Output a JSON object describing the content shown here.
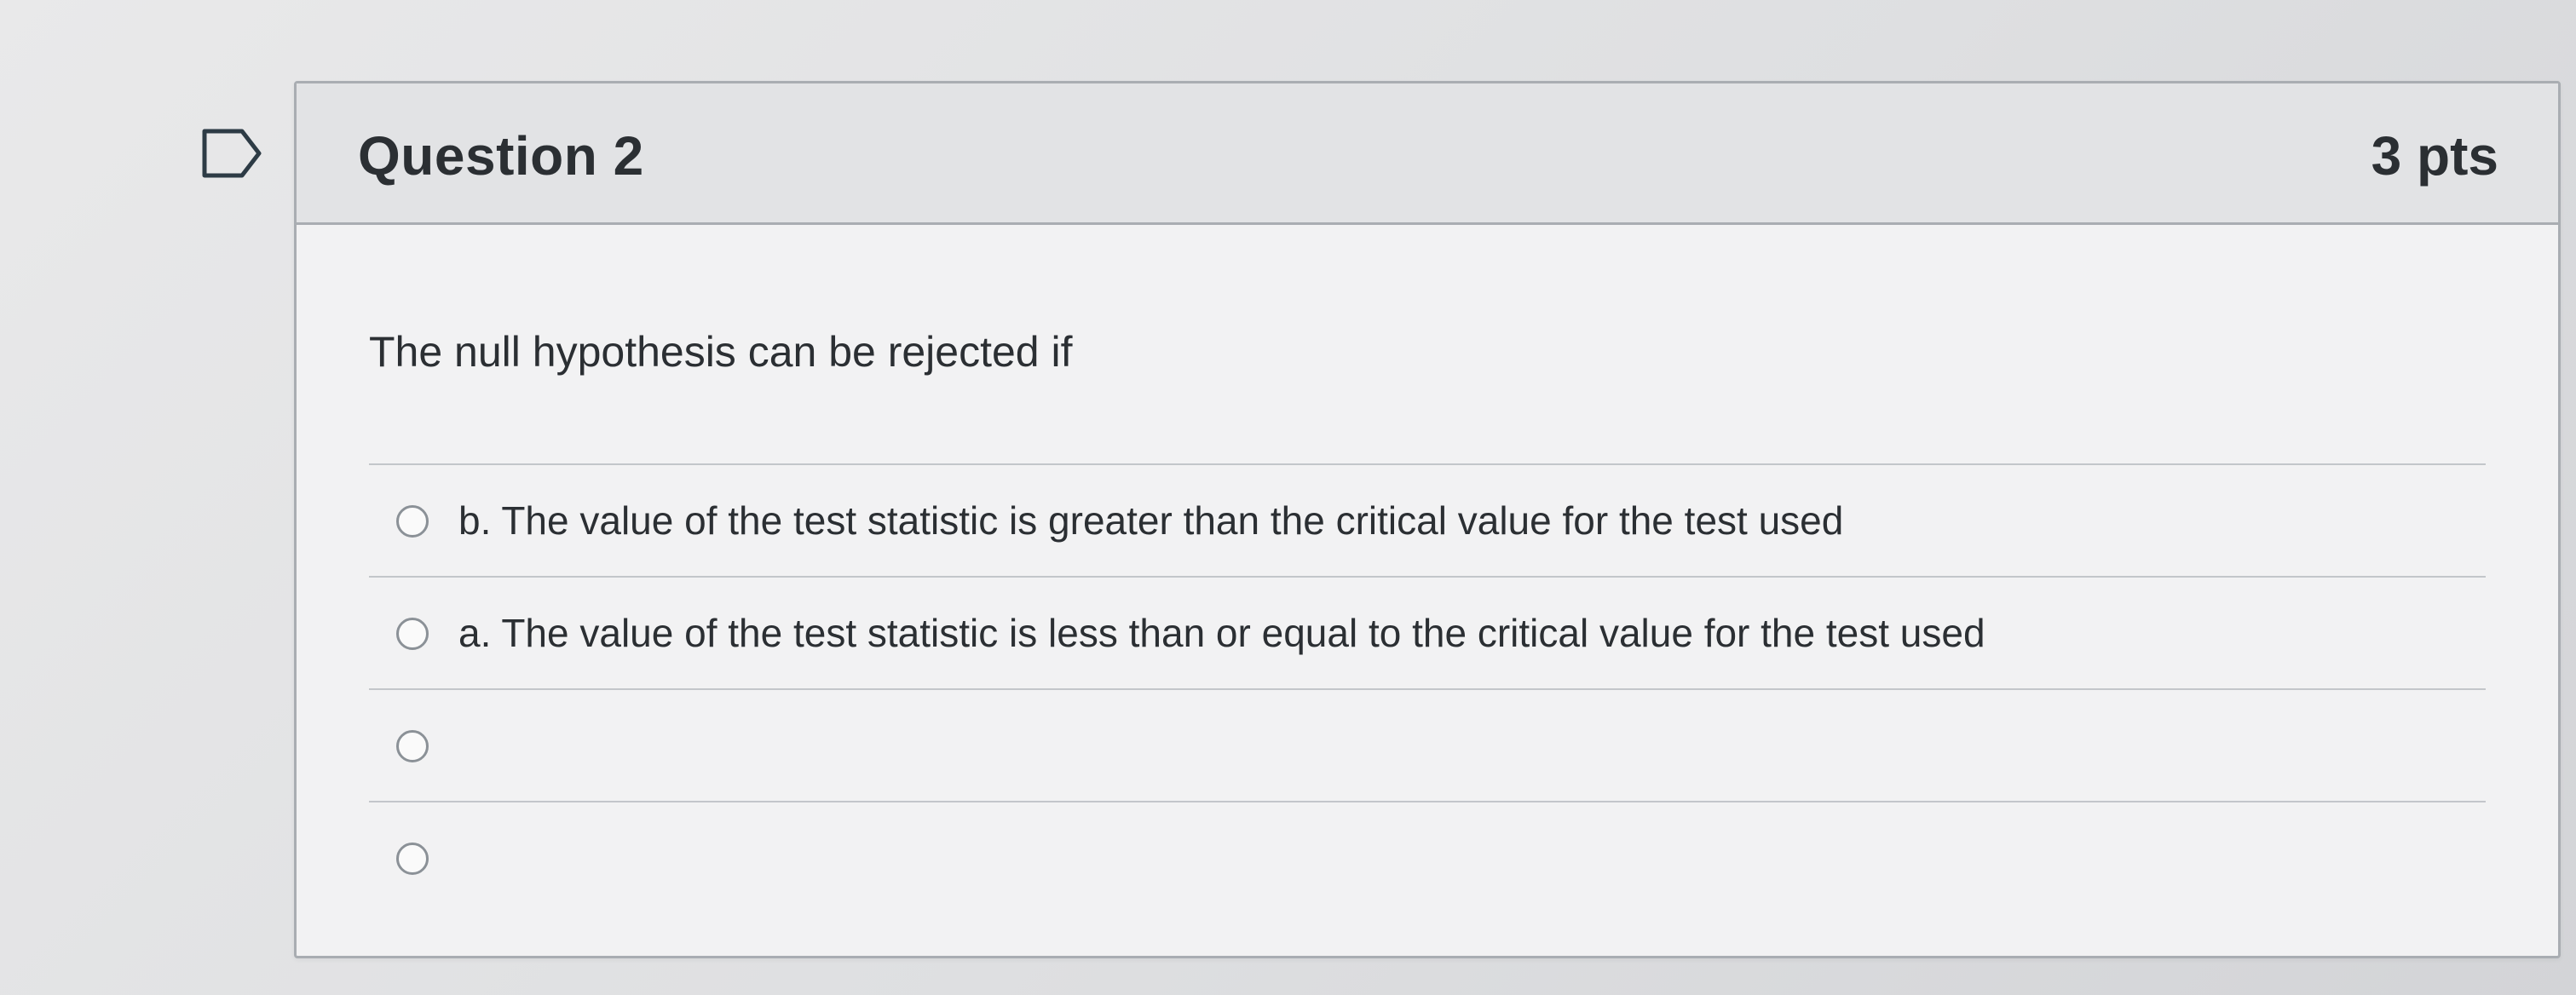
{
  "question": {
    "title": "Question 2",
    "points": "3 pts",
    "prompt": "The null hypothesis can be rejected if",
    "icon": "bookmark-icon",
    "answers": [
      {
        "label": "b. The value of the test statistic is greater than the critical value for the test used",
        "selected": false
      },
      {
        "label": "a. The value of the test statistic is less than or equal to the critical value for the test used",
        "selected": false
      },
      {
        "label": "",
        "selected": false
      },
      {
        "label": "",
        "selected": false
      }
    ]
  },
  "colors": {
    "border": "#a9adb2",
    "header_background": "#e2e3e5",
    "text": "#2b2f33",
    "radio_border": "#8b9197"
  }
}
